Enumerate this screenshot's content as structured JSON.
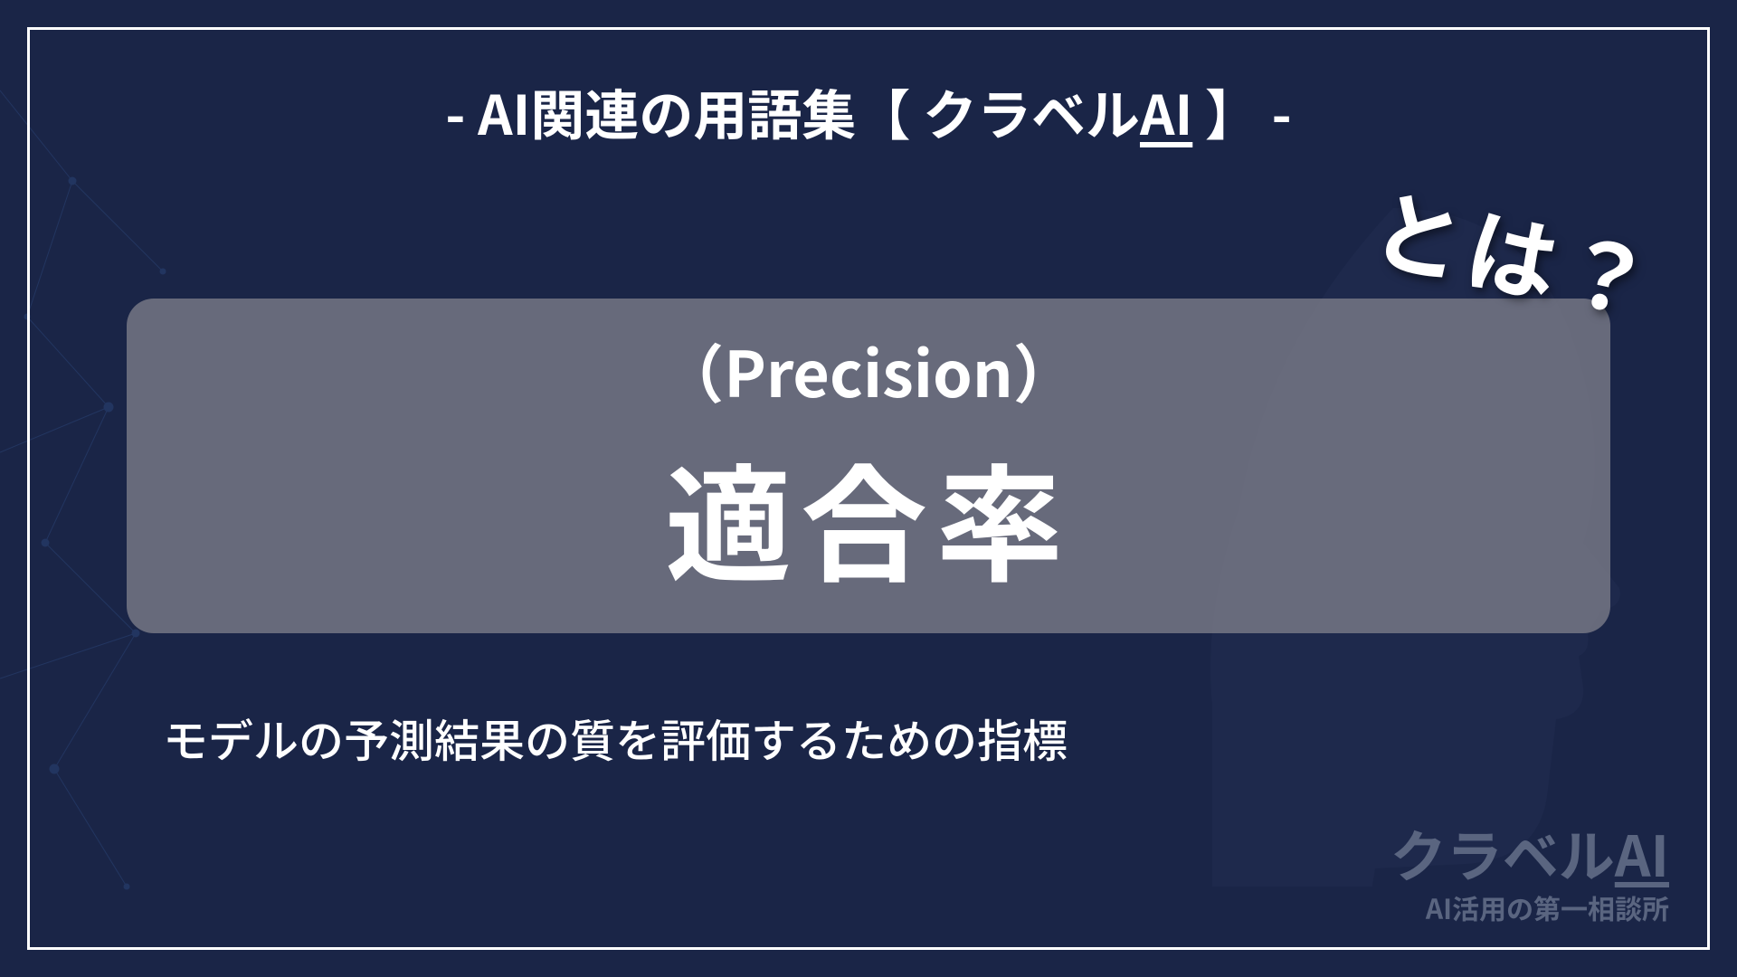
{
  "header": {
    "prefix": "- AI関連の用語集【 クラベル",
    "ai": "AI",
    "suffix": " 】 -"
  },
  "main": {
    "subtitle_en": "（Precision）",
    "title_jp": "適合率"
  },
  "question_badge": "とは？",
  "description": "モデルの予測結果の質を評価するための指標",
  "footer": {
    "brand_prefix": "クラベル",
    "brand_ai": "AI",
    "tagline": "AI活用の第一相談所"
  }
}
